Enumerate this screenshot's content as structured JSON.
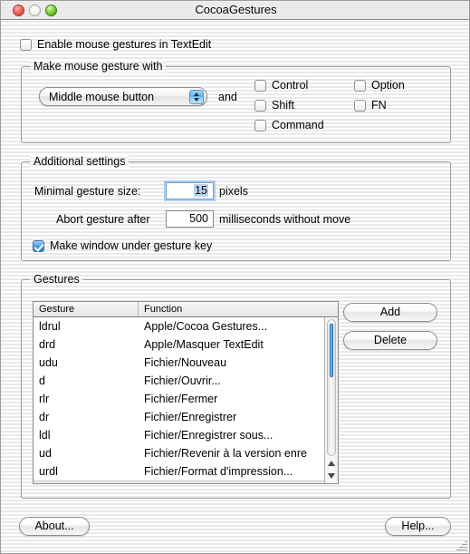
{
  "window": {
    "title": "CocoaGestures",
    "traffic_lights": [
      "close-button",
      "minimize-button",
      "zoom-button"
    ]
  },
  "enable": {
    "label": "Enable mouse gestures in TextEdit",
    "checked": false
  },
  "gesture_with": {
    "group_title": "Make mouse gesture with",
    "popup_value": "Middle mouse button",
    "popup_options": [
      "Middle mouse button"
    ],
    "and_label": "and",
    "modifiers": [
      {
        "label": "Control",
        "checked": false
      },
      {
        "label": "Shift",
        "checked": false
      },
      {
        "label": "Command",
        "checked": false
      },
      {
        "label": "Option",
        "checked": false
      },
      {
        "label": "FN",
        "checked": false
      }
    ]
  },
  "additional": {
    "group_title": "Additional settings",
    "min_size_label": "Minimal gesture size:",
    "min_size_value": "15",
    "min_size_unit": "pixels",
    "abort_label": "Abort gesture after",
    "abort_value": "500",
    "abort_unit": "milliseconds without move",
    "make_window_label": "Make window under gesture key",
    "make_window_checked": true
  },
  "gestures": {
    "group_title": "Gestures",
    "columns": [
      "Gesture",
      "Function"
    ],
    "rows": [
      {
        "gesture": "ldrul",
        "function": "Apple/Cocoa Gestures..."
      },
      {
        "gesture": "drd",
        "function": "Apple/Masquer TextEdit"
      },
      {
        "gesture": "udu",
        "function": "Fichier/Nouveau"
      },
      {
        "gesture": "d",
        "function": "Fichier/Ouvrir..."
      },
      {
        "gesture": "rlr",
        "function": "Fichier/Fermer"
      },
      {
        "gesture": "dr",
        "function": "Fichier/Enregistrer"
      },
      {
        "gesture": "ldl",
        "function": "Fichier/Enregistrer sous..."
      },
      {
        "gesture": "ud",
        "function": "Fichier/Revenir à la version enre"
      },
      {
        "gesture": "urdl",
        "function": "Fichier/Format d'impression..."
      }
    ],
    "add_label": "Add",
    "delete_label": "Delete"
  },
  "footer": {
    "about_label": "About...",
    "help_label": "Help..."
  },
  "colors": {
    "accent": "#4e9fe0",
    "close": "#f1685d",
    "zoom": "#7fd23c",
    "selection": "#b9d6ef"
  }
}
